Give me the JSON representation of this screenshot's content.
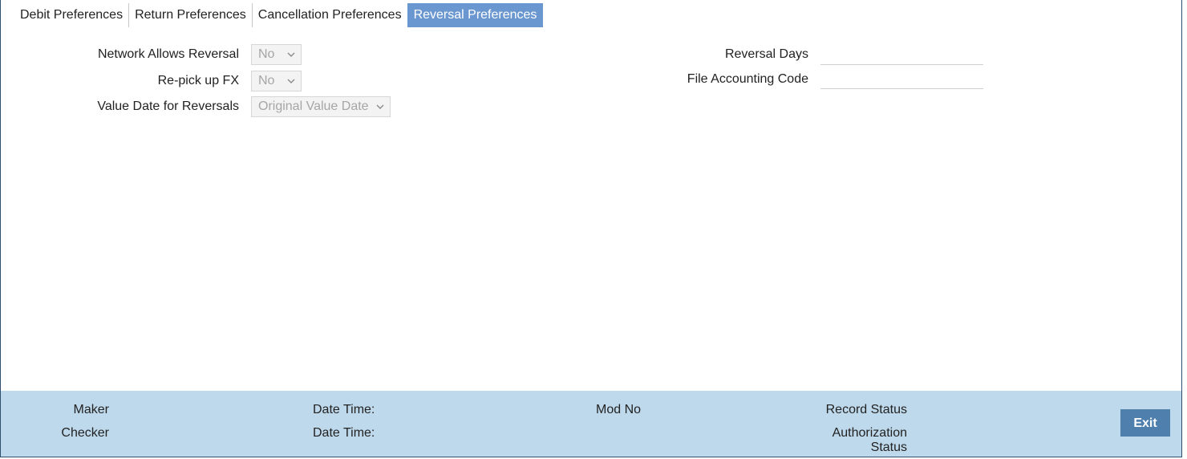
{
  "tabs": [
    {
      "label": "Debit Preferences",
      "active": false
    },
    {
      "label": "Return Preferences",
      "active": false
    },
    {
      "label": "Cancellation Preferences",
      "active": false
    },
    {
      "label": "Reversal Preferences",
      "active": true
    }
  ],
  "form": {
    "network_allows_reversal": {
      "label": "Network Allows Reversal",
      "value": "No"
    },
    "repick_fx": {
      "label": "Re-pick up FX",
      "value": "No"
    },
    "value_date_for_reversals": {
      "label": "Value Date for Reversals",
      "value": "Original Value Date"
    },
    "reversal_days": {
      "label": "Reversal Days",
      "value": ""
    },
    "file_accounting_code": {
      "label": "File Accounting Code",
      "value": ""
    }
  },
  "footer": {
    "maker": "Maker",
    "checker": "Checker",
    "date_time_1": "Date Time:",
    "date_time_2": "Date Time:",
    "mod_no": "Mod No",
    "record_status": "Record Status",
    "authorization_status_line1": "Authorization",
    "authorization_status_line2": "Status",
    "exit_label": "Exit"
  },
  "colors": {
    "active_tab": "#6a97cf",
    "footer_bg": "#bfd9ec",
    "exit_button": "#4e7fad"
  }
}
